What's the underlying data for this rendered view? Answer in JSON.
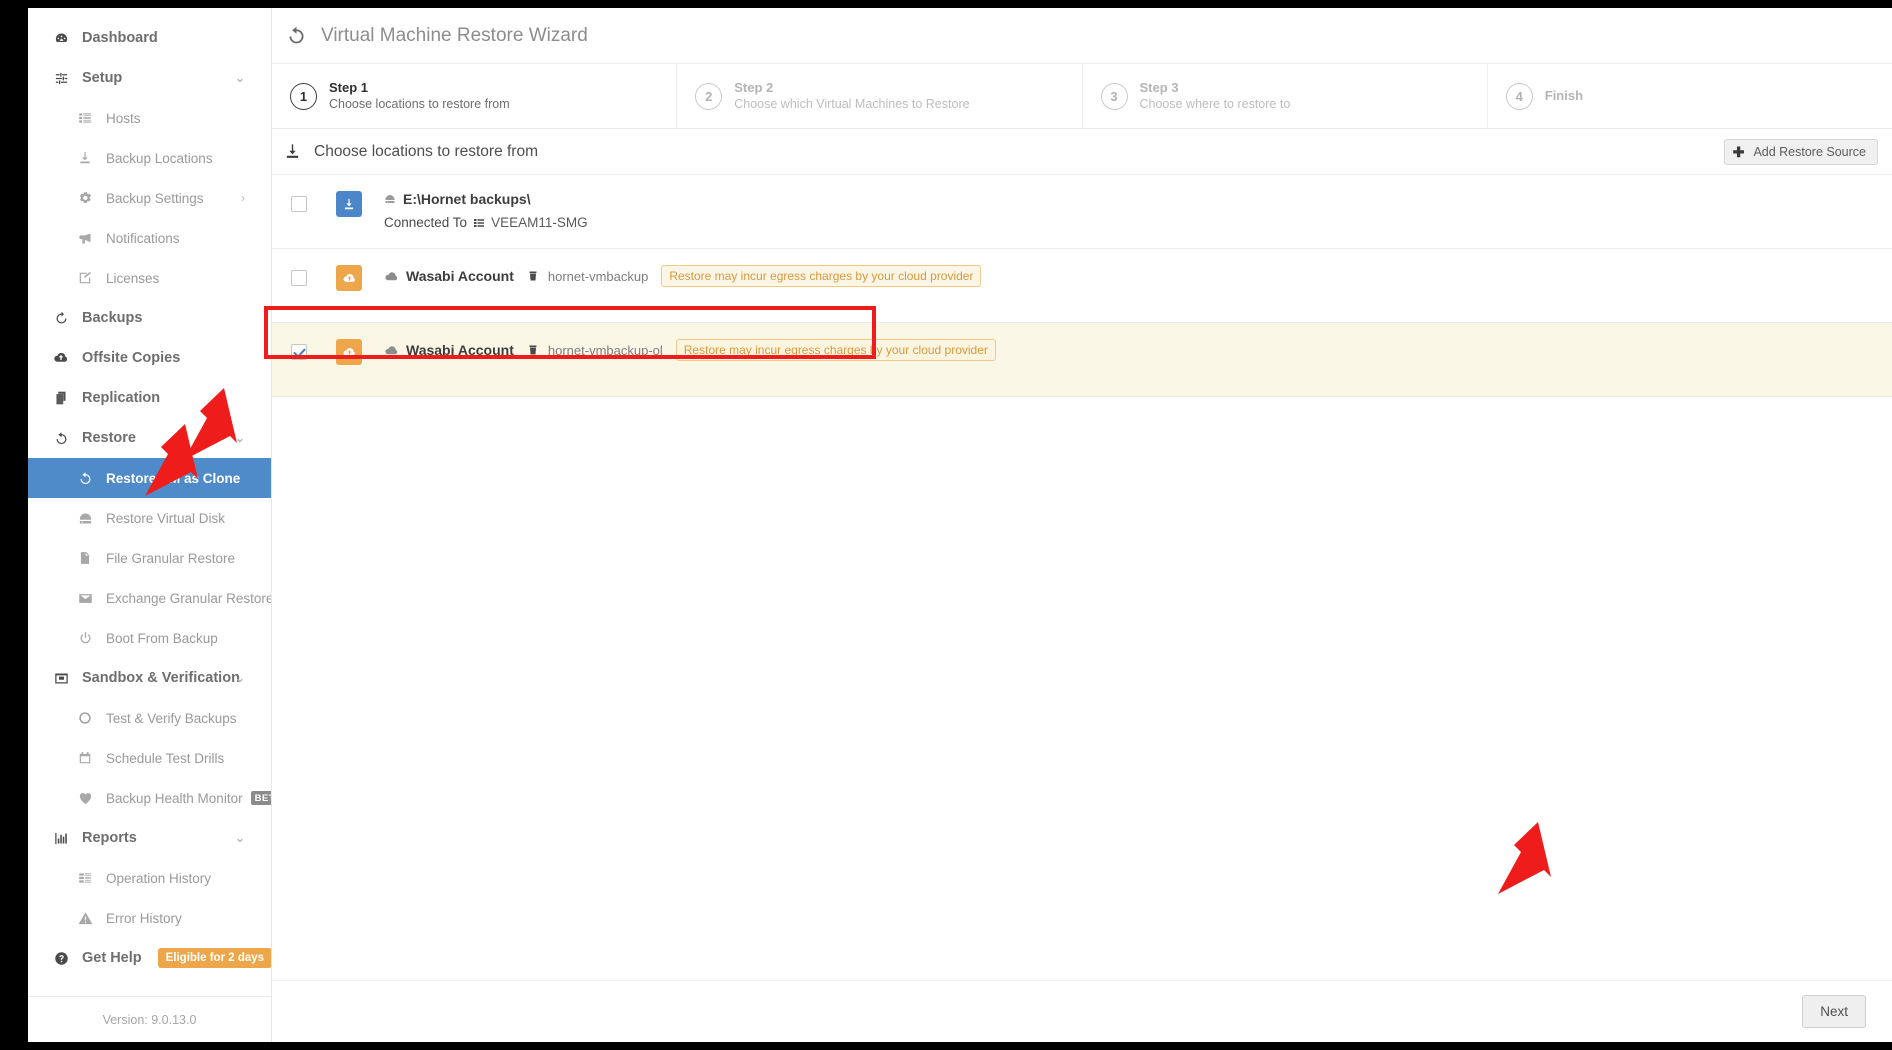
{
  "sidebar": {
    "items": [
      {
        "label": "Dashboard",
        "icon": "dashboard-icon",
        "level": "top",
        "chevron": "",
        "active": false
      },
      {
        "label": "Setup",
        "icon": "sliders-icon",
        "level": "top",
        "chevron": "⌄",
        "active": false
      },
      {
        "label": "Hosts",
        "icon": "list-icon",
        "level": "sub",
        "chevron": "",
        "active": false
      },
      {
        "label": "Backup Locations",
        "icon": "download-icon",
        "level": "sub",
        "chevron": "",
        "active": false
      },
      {
        "label": "Backup Settings",
        "icon": "gears-icon",
        "level": "sub",
        "chevron": "›",
        "active": false
      },
      {
        "label": "Notifications",
        "icon": "megaphone-icon",
        "level": "sub",
        "chevron": "",
        "active": false
      },
      {
        "label": "Licenses",
        "icon": "edit-icon",
        "level": "sub",
        "chevron": "",
        "active": false
      },
      {
        "label": "Backups",
        "icon": "refresh-icon",
        "level": "top",
        "chevron": "",
        "active": false
      },
      {
        "label": "Offsite Copies",
        "icon": "cloud-upload-icon",
        "level": "top",
        "chevron": "",
        "active": false
      },
      {
        "label": "Replication",
        "icon": "copy-icon",
        "level": "top",
        "chevron": "",
        "active": false
      },
      {
        "label": "Restore",
        "icon": "restore-icon",
        "level": "top",
        "chevron": "⌄",
        "active": false
      },
      {
        "label": "Restore VM as Clone",
        "icon": "restore-icon",
        "level": "sub",
        "chevron": "",
        "active": true
      },
      {
        "label": "Restore Virtual Disk",
        "icon": "disk-icon",
        "level": "sub",
        "chevron": "",
        "active": false
      },
      {
        "label": "File Granular Restore",
        "icon": "file-icon",
        "level": "sub",
        "chevron": "",
        "active": false
      },
      {
        "label": "Exchange Granular Restore",
        "icon": "envelope-icon",
        "level": "sub",
        "chevron": "",
        "active": false
      },
      {
        "label": "Boot From Backup",
        "icon": "power-icon",
        "level": "sub",
        "chevron": "",
        "active": false
      },
      {
        "label": "Sandbox & Verification",
        "icon": "sandbox-icon",
        "level": "top",
        "chevron": "⌄",
        "active": false
      },
      {
        "label": "Test & Verify Backups",
        "icon": "circle-icon",
        "level": "sub",
        "chevron": "",
        "active": false
      },
      {
        "label": "Schedule Test Drills",
        "icon": "calendar-icon",
        "level": "sub",
        "chevron": "",
        "active": false
      },
      {
        "label": "Backup Health Monitor",
        "icon": "heartbeat-icon",
        "level": "sub",
        "chevron": "",
        "active": false,
        "badge": "BETA"
      },
      {
        "label": "Reports",
        "icon": "chart-icon",
        "level": "top",
        "chevron": "⌄",
        "active": false
      },
      {
        "label": "Operation History",
        "icon": "rows-icon",
        "level": "sub",
        "chevron": "",
        "active": false
      },
      {
        "label": "Error History",
        "icon": "warning-icon",
        "level": "sub",
        "chevron": "",
        "active": false
      },
      {
        "label": "Get Help",
        "icon": "question-icon",
        "level": "top",
        "chevron": "",
        "active": false,
        "help_badge": "Eligible for 2 days"
      }
    ],
    "version": "Version: 9.0.13.0"
  },
  "wizard": {
    "title": "Virtual Machine Restore Wizard",
    "title_icon": "restore-icon",
    "steps": [
      {
        "name": "Step 1",
        "desc": "Choose locations to restore from",
        "number": "1",
        "current": true
      },
      {
        "name": "Step 2",
        "desc": "Choose which Virtual Machines to Restore",
        "number": "2",
        "current": false
      },
      {
        "name": "Step 3",
        "desc": "Choose where to restore to",
        "number": "3",
        "current": false
      },
      {
        "name": "Finish",
        "desc": "",
        "number": "4",
        "current": false
      }
    ]
  },
  "subbar": {
    "heading": "Choose locations to restore from",
    "heading_icon": "download-icon",
    "add_button": "Add Restore Source",
    "add_button_icon": "plus-icon"
  },
  "locations": [
    {
      "checked": false,
      "selected": false,
      "icon": "download-box-icon",
      "icon_color": "#4a86c8",
      "path_icon": "drive-icon",
      "title": "E:\\Hornet backups\\",
      "connected_label": "Connected To",
      "connected_icon": "server-icon",
      "connected_host": "VEEAM11-SMG",
      "bucket": "",
      "warning": ""
    },
    {
      "checked": false,
      "selected": false,
      "icon": "cloud-upload-box-icon",
      "icon_color": "#eda74a",
      "path_icon": "cloud-icon",
      "title": "Wasabi Account",
      "connected_label": "",
      "connected_icon": "",
      "connected_host": "",
      "bucket_icon": "bucket-icon",
      "bucket": "hornet-vmbackup",
      "warning": "Restore may incur egress charges by your cloud provider"
    },
    {
      "checked": true,
      "selected": true,
      "icon": "cloud-upload-box-icon",
      "icon_color": "#eda74a",
      "path_icon": "cloud-icon",
      "title": "Wasabi Account",
      "connected_label": "",
      "connected_icon": "",
      "connected_host": "",
      "bucket_icon": "bucket-icon",
      "bucket": "hornet-vmbackup-ol",
      "warning": "Restore may incur egress charges by your cloud provider"
    }
  ],
  "footer": {
    "next_label": "Next"
  },
  "colors": {
    "accent_blue": "#4f8ac9",
    "accent_orange": "#eda74a",
    "selected_row": "#faf7e6",
    "annotation_red": "#ef1c1c",
    "warning_text": "#d59a3d"
  }
}
